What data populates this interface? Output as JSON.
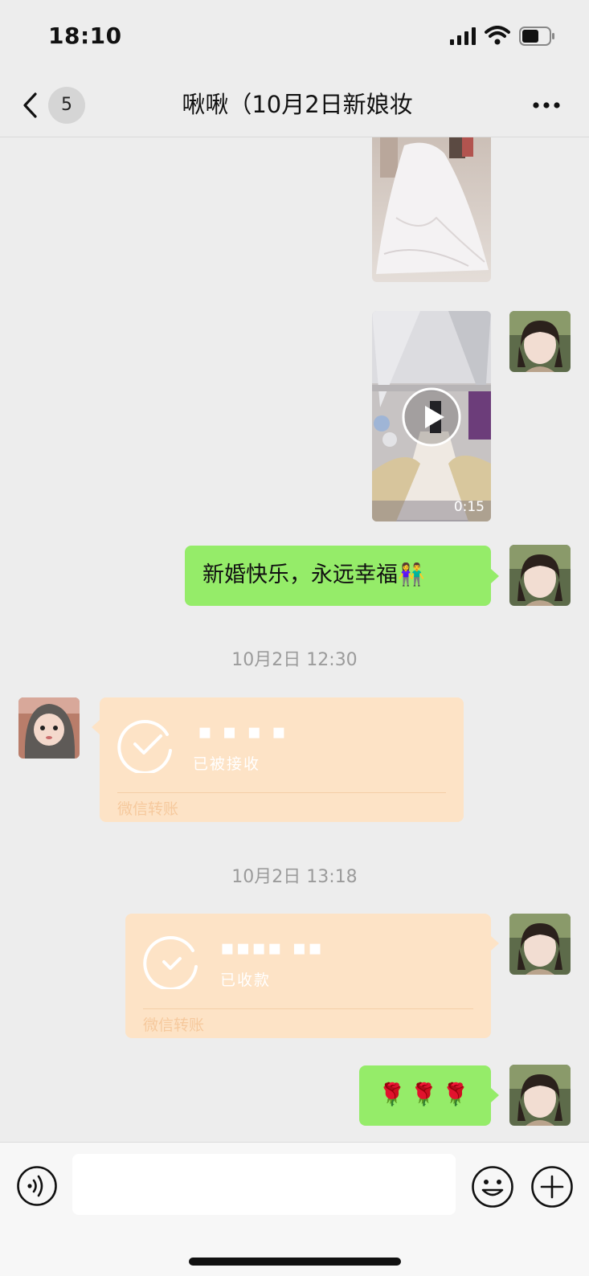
{
  "status_bar": {
    "time": "18:10"
  },
  "nav": {
    "unread_count": "5",
    "title": "啾啾（10月2日新娘妆"
  },
  "messages": {
    "video_duration": "0:15",
    "greeting_text": "新婚快乐，永远幸福👫",
    "timestamp_1": "10月2日 12:30",
    "transfer_1": {
      "amount": "▪ ▪   ▪ ▪",
      "status": "已被接收",
      "label": "微信转账"
    },
    "timestamp_2": "10月2日 13:18",
    "transfer_2": {
      "amount": "▪▪▪▪ ▪▪",
      "status": "已收款",
      "label": "微信转账"
    },
    "roses_text": "🌹🌹🌹"
  },
  "input": {
    "placeholder": ""
  },
  "colors": {
    "background": "#ededed",
    "bubble_green": "#95ec69",
    "transfer_peach": "#fde3c6",
    "timestamp_gray": "#9b9b9b"
  },
  "icons": [
    "back-icon",
    "more-icon",
    "play-icon",
    "check-circle-icon",
    "voice-icon",
    "emoji-icon",
    "plus-icon",
    "signal-icon",
    "wifi-icon",
    "battery-icon"
  ]
}
